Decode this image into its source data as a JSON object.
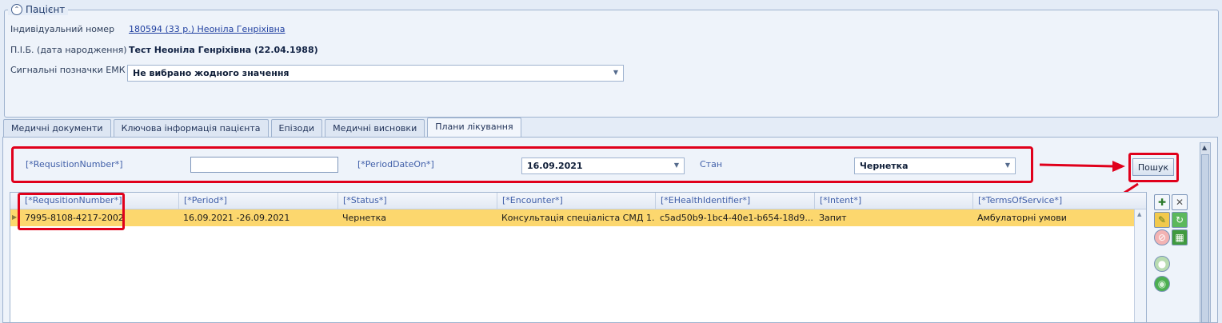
{
  "patient": {
    "group_title": "Пацієнт",
    "collapse_icon": "chevron-up-icon",
    "id_label": "Індивідуальний номер",
    "id_value": "180594 (33 р.) Неоніла Генріхівна",
    "name_label": "П.І.Б. (дата народження)",
    "name_value": "Тест Неоніла Генріхівна (22.04.1988)",
    "flags_label": "Сигнальні позначки ЕМК",
    "flags_value": "Не вибрано жодного значення"
  },
  "tabs": [
    {
      "label": "Медичні документи"
    },
    {
      "label": "Ключова інформація пацієнта"
    },
    {
      "label": "Епізоди"
    },
    {
      "label": "Медичні висновки"
    },
    {
      "label": "Плани лікування",
      "active": true
    }
  ],
  "filters": {
    "requisition_label": "[*RequsitionNumber*]",
    "requisition_value": "",
    "period_label": "[*PeriodDateOn*]",
    "period_value": "16.09.2021",
    "state_label": "Стан",
    "state_value": "Чернетка",
    "search_button": "Пошук"
  },
  "grid": {
    "columns": [
      "[*RequsitionNumber*]",
      "[*Period*]",
      "[*Status*]",
      "[*Encounter*]",
      "[*EHealthIdentifier*]",
      "[*Intent*]",
      "[*TermsOfService*]"
    ],
    "rows": [
      [
        "7995-8108-4217-2002",
        "16.09.2021 -26.09.2021",
        "Чернетка",
        "Консультація спеціаліста СМД 1...",
        "c5ad50b9-1bc4-40e1-b654-18d9...",
        "Запит",
        "Амбулаторні умови"
      ]
    ]
  },
  "colors": {
    "highlight": "#e0001b",
    "selected_row": "#fcd76e",
    "header_text": "#3f5ea8"
  }
}
